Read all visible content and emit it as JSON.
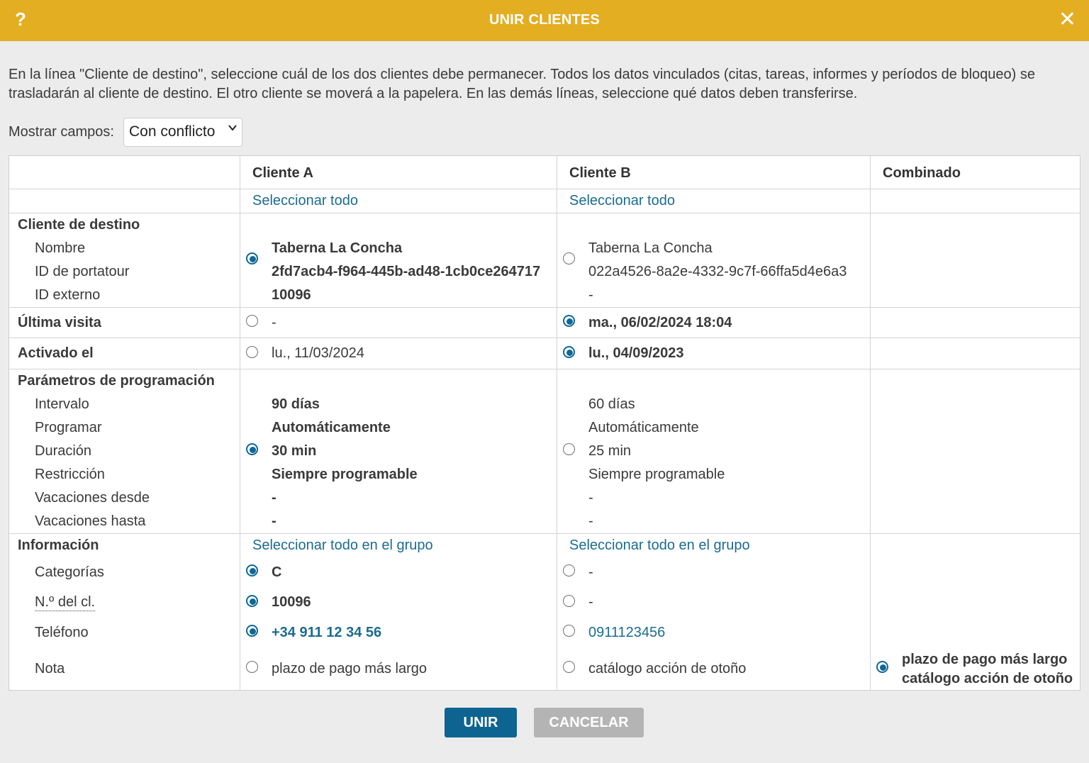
{
  "header": {
    "help": "?",
    "title": "UNIR CLIENTES",
    "close": "✕"
  },
  "intro": "En la línea \"Cliente de destino\", seleccione cuál de los dos clientes debe permanecer. Todos los datos vinculados (citas, tareas, informes y períodos de bloqueo) se trasladarán al cliente de destino. El otro cliente se moverá a la papelera. En las demás líneas, seleccione qué datos deben transferirse.",
  "filter": {
    "label": "Mostrar campos:",
    "value": "Con conflicto"
  },
  "columns": {
    "a": "Cliente A",
    "b": "Cliente B",
    "combined": "Combinado"
  },
  "select_all": "Seleccionar todo",
  "select_all_group": "Seleccionar todo en el grupo",
  "target": {
    "label": "Cliente de destino",
    "fields": [
      "Nombre",
      "ID de portatour",
      "ID externo"
    ],
    "a": [
      "Taberna La Concha",
      "2fd7acb4-f964-445b-ad48-1cb0ce264717",
      "10096"
    ],
    "b": [
      "Taberna La Concha",
      "022a4526-8a2e-4332-9c7f-66ffa5d4e6a3",
      "-"
    ],
    "selected": "a"
  },
  "last_visit": {
    "label": "Última visita",
    "a": "-",
    "b": "ma., 06/02/2024 18:04",
    "selected": "b"
  },
  "activated": {
    "label": "Activado el",
    "a": "lu., 11/03/2024",
    "b": "lu., 04/09/2023",
    "selected": "b"
  },
  "scheduling": {
    "label": "Parámetros de programación",
    "fields": [
      "Intervalo",
      "Programar",
      "Duración",
      "Restricción",
      "Vacaciones desde",
      "Vacaciones hasta"
    ],
    "a": [
      "90 días",
      "Automáticamente",
      "30 min",
      "Siempre programable",
      "-",
      "-"
    ],
    "b": [
      "60 días",
      "Automáticamente",
      "25 min",
      "Siempre programable",
      "-",
      "-"
    ],
    "selected": "a"
  },
  "info": {
    "label": "Información",
    "categories": {
      "label": "Categorías",
      "a": "C",
      "b": "-",
      "selected": "a"
    },
    "customer_no": {
      "label": "N.º del cl.",
      "a": "10096",
      "b": "-",
      "selected": "a"
    },
    "phone": {
      "label": "Teléfono",
      "a": "+34 911 12 34 56",
      "b": "0911123456",
      "selected": "a"
    },
    "note": {
      "label": "Nota",
      "a": "plazo de pago más largo",
      "b": "catálogo acción de otoño",
      "combined": [
        "plazo de pago más largo",
        "catálogo acción de otoño"
      ],
      "selected": "combined"
    }
  },
  "buttons": {
    "merge": "UNIR",
    "cancel": "CANCELAR"
  },
  "colors": {
    "accent": "#e4ae22",
    "primary": "#0d6490",
    "link": "#1b6c8f",
    "radio": "#0e6896"
  }
}
